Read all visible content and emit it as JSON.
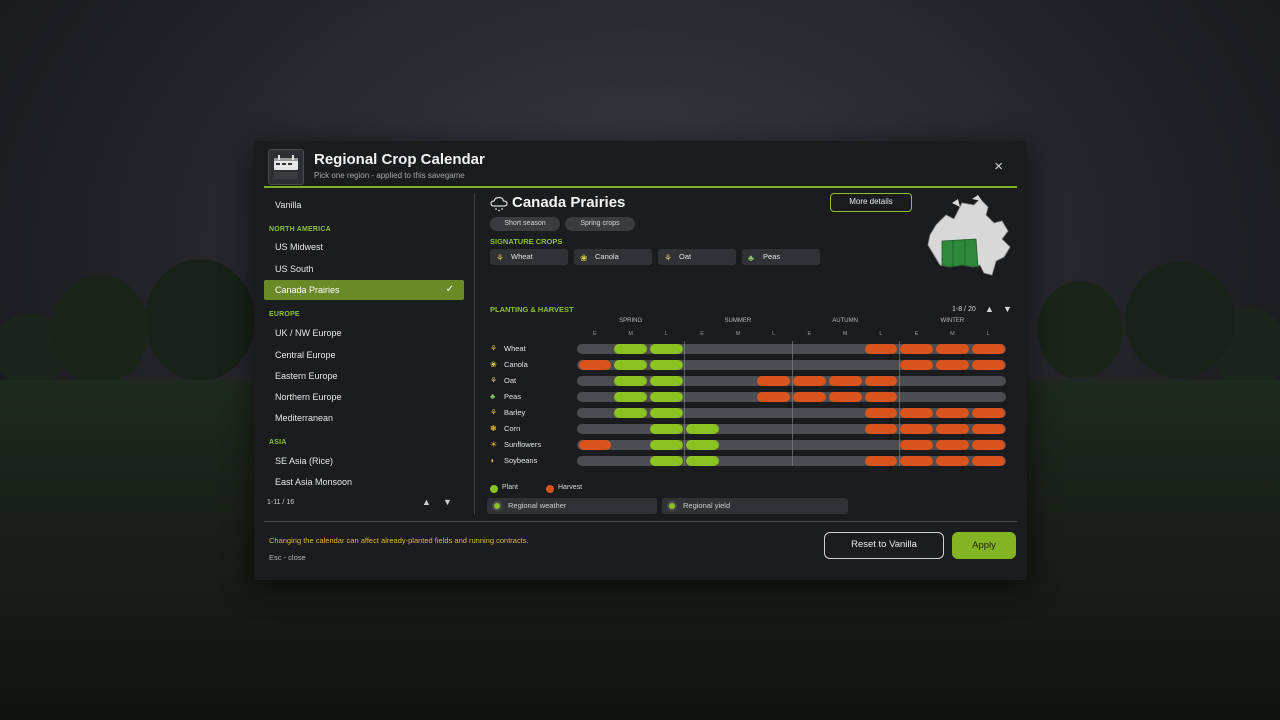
{
  "header": {
    "title": "Regional Crop Calendar",
    "subtitle": "Pick one region - applied to this savegame",
    "logo_text": "REGIONAL CROP CALENDAR",
    "close": "×"
  },
  "sidebar": {
    "items": [
      {
        "kind": "item",
        "label": "Vanilla"
      },
      {
        "kind": "group",
        "label": "NORTH AMERICA"
      },
      {
        "kind": "item",
        "label": "US Midwest"
      },
      {
        "kind": "item",
        "label": "US South"
      },
      {
        "kind": "item",
        "label": "Canada Prairies",
        "selected": true
      },
      {
        "kind": "group",
        "label": "EUROPE"
      },
      {
        "kind": "item",
        "label": "UK / NW Europe"
      },
      {
        "kind": "item",
        "label": "Central Europe"
      },
      {
        "kind": "item",
        "label": "Eastern Europe"
      },
      {
        "kind": "item",
        "label": "Northern Europe"
      },
      {
        "kind": "item",
        "label": "Mediterranean"
      },
      {
        "kind": "group",
        "label": "ASIA"
      },
      {
        "kind": "item",
        "label": "SE Asia (Rice)"
      },
      {
        "kind": "item",
        "label": "East Asia Monsoon"
      }
    ],
    "check": "✓",
    "pager": "1-11 / 16",
    "arrow_up": "▲",
    "arrow_down": "▼"
  },
  "main": {
    "region_title": "Canada Prairies",
    "tags": [
      "Short season",
      "Spring crops"
    ],
    "more_details": "More details",
    "signature_label": "SIGNATURE CROPS",
    "signature_crops": [
      {
        "name": "Wheat",
        "icon": "wheat-icon"
      },
      {
        "name": "Canola",
        "icon": "canola-icon"
      },
      {
        "name": "Oat",
        "icon": "oat-icon"
      },
      {
        "name": "Peas",
        "icon": "peas-icon"
      }
    ],
    "calendar_label": "PLANTING & HARVEST",
    "calendar_pager": "1-8 / 20",
    "arrow_up": "▲",
    "arrow_down": "▼",
    "seasons": [
      "SPRING",
      "SUMMER",
      "AUTUMN",
      "WINTER"
    ],
    "subperiods": [
      "E",
      "M",
      "L"
    ],
    "crops": [
      {
        "name": "Wheat",
        "icon": "wheat-icon",
        "periods": [
          "",
          "P",
          "P",
          "",
          "",
          "",
          "",
          "",
          "H",
          "H",
          "H",
          "H"
        ]
      },
      {
        "name": "Canola",
        "icon": "canola-icon",
        "periods": [
          "H",
          "P",
          "P",
          "",
          "",
          "",
          "",
          "",
          "",
          "H",
          "H",
          "H"
        ]
      },
      {
        "name": "Oat",
        "icon": "oat-icon",
        "periods": [
          "",
          "P",
          "P",
          "",
          "",
          "H",
          "H",
          "H",
          "H",
          "",
          "",
          ""
        ]
      },
      {
        "name": "Peas",
        "icon": "peas-icon",
        "periods": [
          "",
          "P",
          "P",
          "",
          "",
          "H",
          "H",
          "H",
          "H",
          "",
          "",
          ""
        ]
      },
      {
        "name": "Barley",
        "icon": "barley-icon",
        "periods": [
          "",
          "P",
          "P",
          "",
          "",
          "",
          "",
          "",
          "H",
          "H",
          "H",
          "H"
        ]
      },
      {
        "name": "Corn",
        "icon": "corn-icon",
        "periods": [
          "",
          "",
          "P",
          "P",
          "",
          "",
          "",
          "",
          "H",
          "H",
          "H",
          "H"
        ]
      },
      {
        "name": "Sunflowers",
        "icon": "sunflower-icon",
        "periods": [
          "H",
          "",
          "P",
          "P",
          "",
          "",
          "",
          "",
          "",
          "H",
          "H",
          "H"
        ]
      },
      {
        "name": "Soybeans",
        "icon": "soybean-icon",
        "periods": [
          "",
          "",
          "P",
          "P",
          "",
          "",
          "",
          "",
          "H",
          "H",
          "H",
          "H"
        ]
      }
    ],
    "legend": {
      "plant": "Plant",
      "harvest": "Harvest"
    },
    "toggles": [
      "Regional weather",
      "Regional yield"
    ]
  },
  "footer": {
    "warning": "Changing the calendar can affect already-planted fields and running contracts.",
    "esc_hint": "Esc - close",
    "reset": "Reset to Vanilla",
    "apply": "Apply"
  },
  "colors": {
    "accent": "#8cc035",
    "plant": "#8bc120",
    "harvest": "#d9531c",
    "warning": "#e3b63a"
  }
}
